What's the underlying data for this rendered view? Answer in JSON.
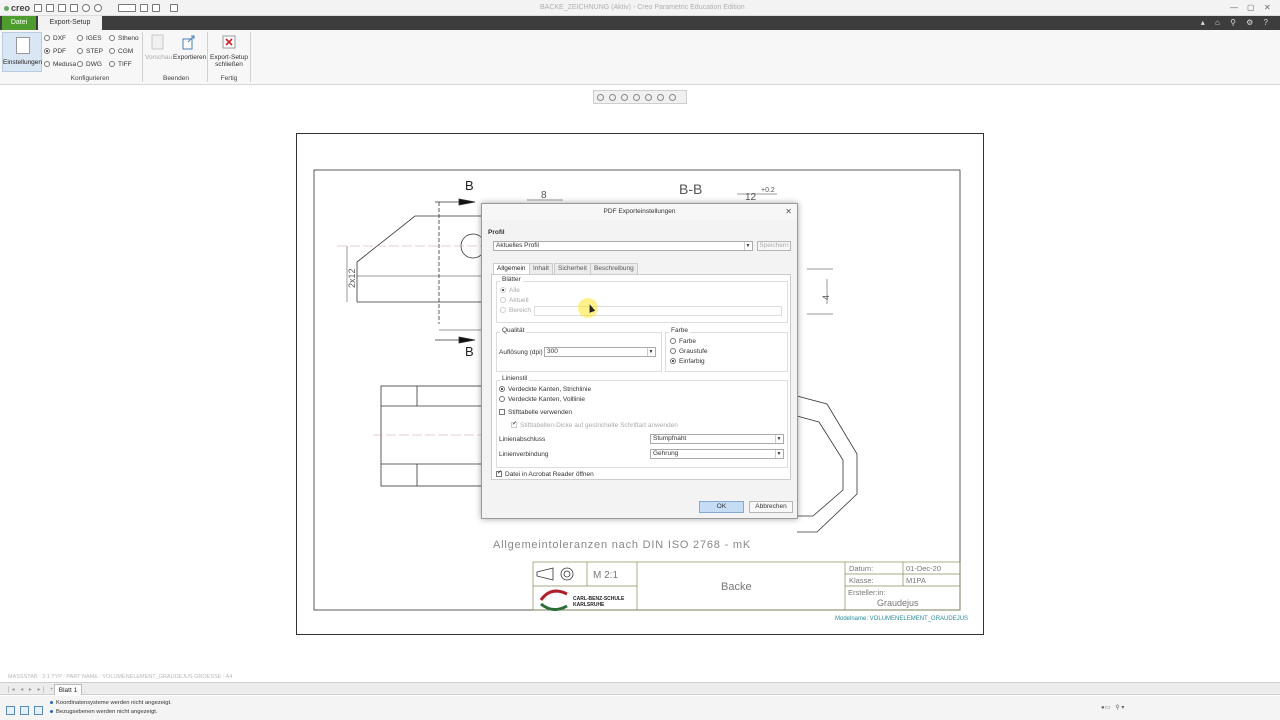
{
  "app": {
    "logo": "creo",
    "window_title": "BACKE_ZEICHNUNG (Aktiv) - Creo Parametric Education Edition"
  },
  "ribbon": {
    "tabs": [
      {
        "label": "Datei"
      },
      {
        "label": "Export-Setup"
      }
    ],
    "einstellungen": "Einstellungen",
    "formats": {
      "dxf": "DXF",
      "pdf": "PDF",
      "medusa": "Medusa",
      "iges": "IGES",
      "step": "STEP",
      "dwg": "DWG",
      "stheno": "Stheno",
      "cgm": "CGM",
      "tiff": "TIFF",
      "selected": "PDF"
    },
    "groups": {
      "konfigurieren": "Konfigurieren",
      "beenden": "Beenden",
      "fertig": "Fertig"
    },
    "buttons": {
      "vorschau": "Vorschau",
      "exportieren": "Exportieren",
      "close_line1": "Export-Setup",
      "close_line2": "schließen"
    }
  },
  "drawing": {
    "section_left_top": "B",
    "section_left_bottom": "B",
    "section_title": "B-B",
    "dim_8": "8",
    "dim_12": "12",
    "dim_tol": "+0.2",
    "dim_2x12": "2x12",
    "dim_4": "4",
    "general_tolerances": "Allgemeintoleranzen nach DIN ISO 2768 - mK",
    "scale": "M 2:1",
    "part_name": "Backe",
    "datum_label": "Datum:",
    "datum_value": "01-Dec-20",
    "klasse_label": "Klasse:",
    "klasse_value": "M1PA",
    "ersteller_label": "Ersteller:in:",
    "ersteller_value": "Graudejus",
    "school_line1": "CARL-BENZ-SCHULE",
    "school_line2": "KARLSRUHE",
    "modelname": "Modelname: VOLUMENELEMENT_GRAUDEJUS"
  },
  "dialog": {
    "title": "PDF Exporteinstellungen",
    "profil_label": "Profil",
    "profil_value": "Aktuelles Profil",
    "speichern": "Speichern",
    "tabs": [
      "Allgemein",
      "Inhalt",
      "Sicherheit",
      "Beschreibung"
    ],
    "active_tab": "Allgemein",
    "blaetter": {
      "label": "Blätter",
      "alle": "Alle",
      "aktuell": "Aktuell",
      "bereich": "Bereich"
    },
    "qualitaet": {
      "label": "Qualität",
      "aufloesung_label": "Auflösung (dpi)",
      "aufloesung_value": "300"
    },
    "farbe": {
      "label": "Farbe",
      "farbe": "Farbe",
      "graustufe": "Graustufe",
      "einfarbig": "Einfarbig",
      "selected": "Einfarbig"
    },
    "linienstil": {
      "label": "Linienstil",
      "opt1": "Verdeckte Kanten, Strichlinie",
      "opt2": "Verdeckte Kanten, Volllinie",
      "stifttabelle": "Stifttabelle verwenden",
      "stifttabelle_dicke": "Stifttabellen-Dicke auf gestrichelte Schriftart anwenden",
      "linienabschluss_label": "Linienabschluss",
      "linienabschluss_value": "Stumpfnaht",
      "linienverbindung_label": "Linienverbindung",
      "linienverbindung_value": "Gehrung"
    },
    "acrobat": "Datei in Acrobat Reader öffnen",
    "ok": "OK",
    "abbrechen": "Abbrechen"
  },
  "bottom": {
    "info_line": "MASSSTAB : 2:1     TYP : PART     NAME : VOLUMENELEMENT_GRAUDEJUS     GROESSE : A4",
    "sheet_tab": "Blatt 1",
    "messages": [
      "Koordinatensysteme werden nicht angezeigt.",
      "Bezugsebenen werden nicht angezeigt."
    ]
  }
}
